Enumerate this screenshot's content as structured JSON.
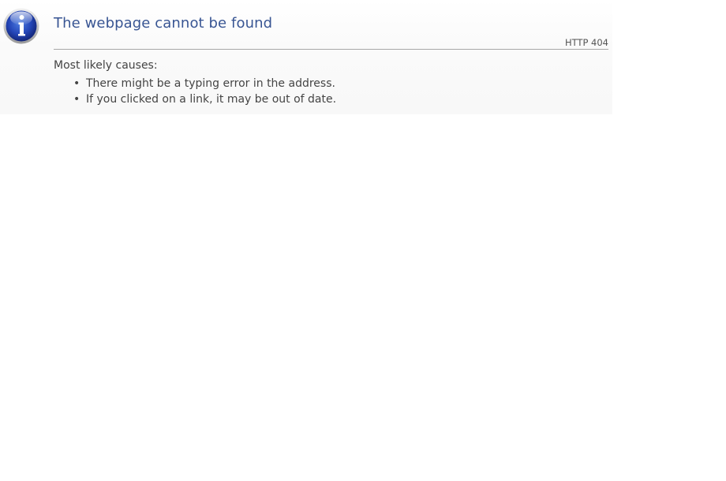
{
  "page": {
    "title": "The webpage cannot be found",
    "status": "HTTP 404",
    "icon": "info-icon",
    "colors": {
      "title": "#385593",
      "text": "#444444",
      "divider": "#a7a7a7",
      "icon_blue": "#1f3fa8"
    }
  },
  "causes": {
    "heading": "Most likely causes:",
    "items": [
      "There might be a typing error in the address.",
      "If you clicked on a link, it may be out of date."
    ]
  }
}
